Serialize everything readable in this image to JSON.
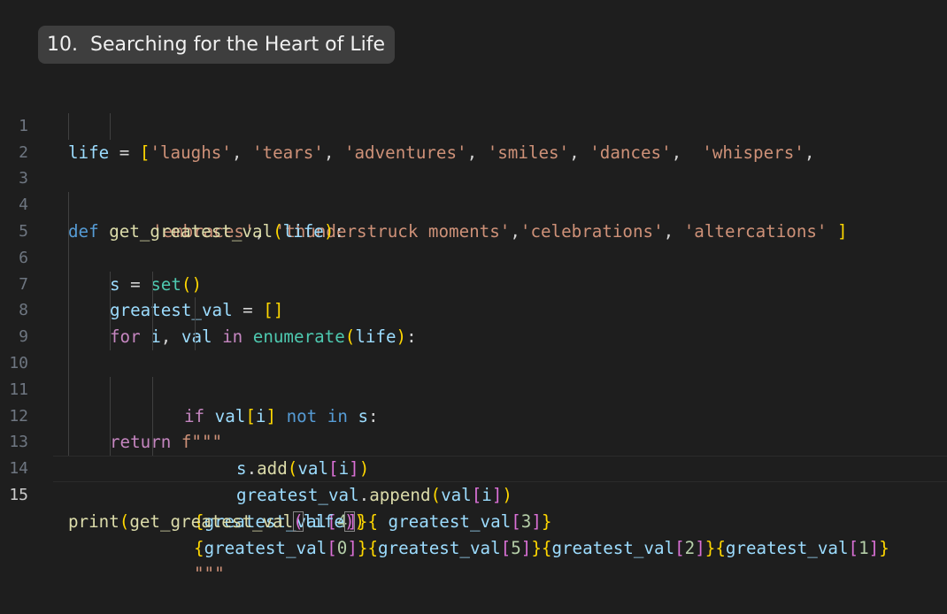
{
  "title": "10.  Searching for the Heart of Life",
  "editor": {
    "language": "python",
    "current_line": 15,
    "lines": [
      {
        "n": "1",
        "text": "life = ['laughs', 'tears', 'adventures', 'smiles', 'dances',  'whispers',"
      },
      {
        "n": "2",
        "text": "        'embraces', 'thunderstruck moments','celebrations', 'altercations' ]"
      },
      {
        "n": "3",
        "text": ""
      },
      {
        "n": "4",
        "text": "def get_greatest_val(life):"
      },
      {
        "n": "5",
        "text": "    s = set()"
      },
      {
        "n": "6",
        "text": "    greatest_val = []"
      },
      {
        "n": "7",
        "text": "    for i, val in enumerate(life):"
      },
      {
        "n": "8",
        "text": "           if val[i] not in s:"
      },
      {
        "n": "9",
        "text": "               s.add(val[i])"
      },
      {
        "n": "10",
        "text": "               greatest_val.append(val[i])"
      },
      {
        "n": "11",
        "text": "    return f\"\"\""
      },
      {
        "n": "12",
        "text": "            {greatest_val[4]}{ greatest_val[3]}"
      },
      {
        "n": "13",
        "text": "            {greatest_val[0]}{greatest_val[5]}{greatest_val[2]}{greatest_val[1]}"
      },
      {
        "n": "14",
        "text": "            \"\"\""
      },
      {
        "n": "15",
        "text": "print(get_greatest_val(life))"
      }
    ]
  },
  "tokens": {
    "l1": [
      "life",
      " = ",
      "[",
      "'laughs'",
      ", ",
      "'tears'",
      ", ",
      "'adventures'",
      ", ",
      "'smiles'",
      ", ",
      "'dances'",
      ",  ",
      "'whispers'",
      ","
    ],
    "l2": [
      "'embraces'",
      ", ",
      "'thunderstruck moments'",
      ",",
      "'celebrations'",
      ", ",
      "'altercations'",
      " ",
      "]"
    ],
    "l4": [
      "def",
      " ",
      "get_greatest_val",
      "(",
      "life",
      ")",
      ":"
    ],
    "l5": [
      "s",
      " = ",
      "set",
      "(",
      ")"
    ],
    "l6": [
      "greatest_val",
      " = ",
      "[",
      "]"
    ],
    "l7": [
      "for",
      " ",
      "i",
      ", ",
      "val",
      " ",
      "in",
      " ",
      "enumerate",
      "(",
      "life",
      ")",
      ":"
    ],
    "l8": [
      "if",
      " ",
      "val",
      "[",
      "i",
      "]",
      " ",
      "not",
      " ",
      "in",
      " ",
      "s",
      ":"
    ],
    "l9": [
      "s",
      ".",
      "add",
      "(",
      "val",
      "[",
      "i",
      "]",
      ")"
    ],
    "l10": [
      "greatest_val",
      ".",
      "append",
      "(",
      "val",
      "[",
      "i",
      "]",
      ")"
    ],
    "l11": [
      "return",
      " ",
      "f\"\"\""
    ],
    "l12": [
      "{",
      "greatest_val",
      "[",
      "4",
      "]",
      "}",
      "{",
      " greatest_val",
      "[",
      "3",
      "]",
      "}"
    ],
    "l13": [
      "{",
      "greatest_val",
      "[",
      "0",
      "]",
      "}",
      "{",
      "greatest_val",
      "[",
      "5",
      "]",
      "}",
      "{",
      "greatest_val",
      "[",
      "2",
      "]",
      "}",
      "{",
      "greatest_val",
      "[",
      "1",
      "]",
      "}"
    ],
    "l14": [
      "\"\"\""
    ],
    "l15": [
      "print",
      "(",
      "get_greatest_val",
      "(",
      "life",
      ")",
      ")"
    ]
  },
  "colors": {
    "background": "#1e1e1e",
    "keyword": "#569cd6",
    "control": "#c586c0",
    "function": "#dcdcaa",
    "variable": "#9cdcfe",
    "string": "#ce9178",
    "builtin": "#4ec9b0",
    "number": "#b5cea8",
    "bracket1": "#ffd700",
    "bracket2": "#da70d6"
  }
}
